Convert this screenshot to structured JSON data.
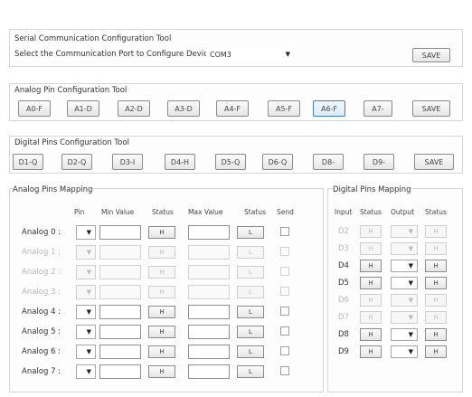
{
  "serial": {
    "title": "Serial Communication Configuration Tool",
    "prompt": "Select the Communication Port to Configure Device :",
    "port_value": "COM3",
    "save_label": "SAVE"
  },
  "analog_pins": {
    "title": "Analog Pin Configuration Tool",
    "buttons": [
      "A0-F",
      "A1-D",
      "A2-D",
      "A3-D",
      "A4-F",
      "A5-F",
      "A6-F",
      "A7-"
    ],
    "save_label": "SAVE"
  },
  "digital_pins": {
    "title": "Digital Pins Configuration Tool",
    "buttons": [
      "D1-Q",
      "D2-Q",
      "D3-I",
      "D4-H",
      "D5-Q",
      "D6-Q",
      "D8-",
      "D9-"
    ],
    "save_label": "SAVE"
  },
  "analog_mapping": {
    "title": "Analog Pins Mapping",
    "headers": {
      "pin": "Pin",
      "min": "Min Value",
      "status1": "Status",
      "max": "Max Value",
      "status2": "Status",
      "send": "Send"
    },
    "rows": [
      {
        "label": "Analog 0 :",
        "status1": "H",
        "status2": "L",
        "enabled": true
      },
      {
        "label": "Analog 1 :",
        "status1": "H",
        "status2": "L",
        "enabled": false
      },
      {
        "label": "Analog 2 :",
        "status1": "H",
        "status2": "L",
        "enabled": false
      },
      {
        "label": "Analog 3 :",
        "status1": "H",
        "status2": "L",
        "enabled": false
      },
      {
        "label": "Analog 4 :",
        "status1": "H",
        "status2": "L",
        "enabled": true
      },
      {
        "label": "Analog 5 :",
        "status1": "H",
        "status2": "L",
        "enabled": true
      },
      {
        "label": "Analog 6 :",
        "status1": "H",
        "status2": "L",
        "enabled": true
      },
      {
        "label": "Analog 7 :",
        "status1": "H",
        "status2": "L",
        "enabled": true
      }
    ]
  },
  "digital_mapping": {
    "title": "Digital Pins Mapping",
    "headers": {
      "input": "Input",
      "status1": "Status",
      "output": "Output",
      "status2": "Status"
    },
    "rows": [
      {
        "label": "D2",
        "status1": "H",
        "status2": "H",
        "enabled": false
      },
      {
        "label": "D3",
        "status1": "H",
        "status2": "H",
        "enabled": false
      },
      {
        "label": "D4",
        "status1": "H",
        "status2": "H",
        "enabled": true
      },
      {
        "label": "D5",
        "status1": "H",
        "status2": "H",
        "enabled": true
      },
      {
        "label": "D6",
        "status1": "H",
        "status2": "H",
        "enabled": false
      },
      {
        "label": "D7",
        "status1": "H",
        "status2": "H",
        "enabled": false
      },
      {
        "label": "D8",
        "status1": "H",
        "status2": "H",
        "enabled": true
      },
      {
        "label": "D9",
        "status1": "H",
        "status2": "H",
        "enabled": true
      }
    ]
  }
}
